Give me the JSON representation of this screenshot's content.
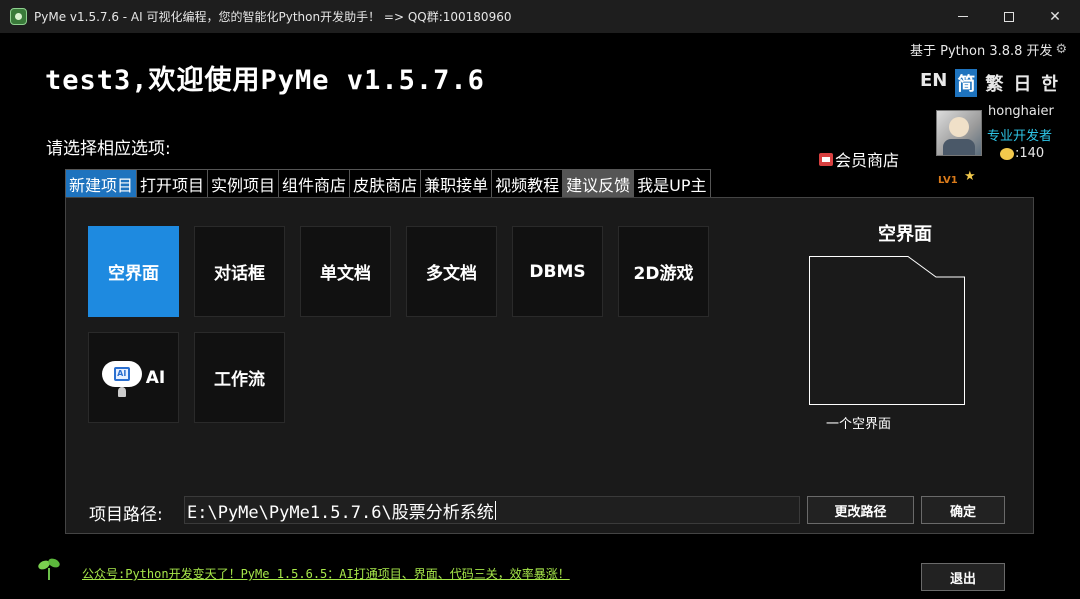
{
  "window": {
    "title": "PyMe v1.5.7.6 - AI 可视化编程，您的智能化Python开发助手！ => QQ群:100180960",
    "minimize_icon": "minimize-icon",
    "maximize_icon": "maximize-icon",
    "close_icon": "close-icon"
  },
  "header": {
    "python_info": "基于 Python 3.8.8 开发",
    "welcome": "test3,欢迎使用PyMe v1.5.7.6",
    "choose_prompt": "请选择相应选项:",
    "languages": [
      "EN",
      "简",
      "繁",
      "日",
      "한"
    ],
    "active_language": "简",
    "vip_shop": "会员商店"
  },
  "user": {
    "name": "honghaier",
    "title": "专业开发者",
    "coins": ":140",
    "level": "LV1"
  },
  "tabs": [
    {
      "label": "新建项目",
      "state": "active"
    },
    {
      "label": "打开项目",
      "state": ""
    },
    {
      "label": "实例项目",
      "state": ""
    },
    {
      "label": "组件商店",
      "state": ""
    },
    {
      "label": "皮肤商店",
      "state": ""
    },
    {
      "label": "兼职接单",
      "state": ""
    },
    {
      "label": "视频教程",
      "state": ""
    },
    {
      "label": "建议反馈",
      "state": "hover"
    },
    {
      "label": "我是UP主",
      "state": ""
    }
  ],
  "templates": [
    {
      "label": "空界面",
      "selected": true
    },
    {
      "label": "对话框",
      "selected": false
    },
    {
      "label": "单文档",
      "selected": false
    },
    {
      "label": "多文档",
      "selected": false
    },
    {
      "label": "DBMS",
      "selected": false
    },
    {
      "label": "2D游戏",
      "selected": false
    },
    {
      "label": "AI",
      "selected": false,
      "icon": "ai-brain-icon"
    },
    {
      "label": "工作流",
      "selected": false
    }
  ],
  "preview": {
    "title": "空界面",
    "description": "一个空界面"
  },
  "project_path": {
    "label": "项目路径:",
    "value": "E:\\PyMe\\PyMe1.5.7.6\\股票分析系统",
    "change_button": "更改路径",
    "ok_button": "确定"
  },
  "footer": {
    "link_text": "公众号:Python开发变天了！PyMe 1.5.6.5：AI打通项目、界面、代码三关，效率暴涨！",
    "exit_button": "退出"
  },
  "colors": {
    "accent": "#1e73be",
    "selected_tile": "#1e8ae0",
    "user_title": "#2ec4e6",
    "footer_link": "#a6e64a",
    "level": "#d97a1a"
  }
}
